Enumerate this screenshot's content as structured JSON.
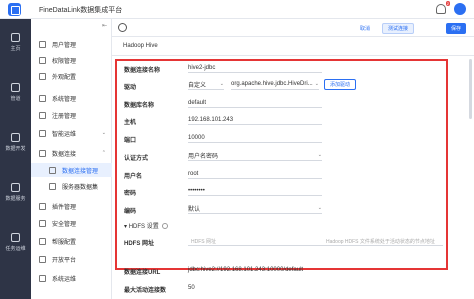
{
  "app": {
    "title": "FineDataLink数据集成平台",
    "notification_count": "2"
  },
  "rail": [
    {
      "label": "主页",
      "icon": "home-icon"
    },
    {
      "label": "管道",
      "icon": "pipeline-icon"
    },
    {
      "label": "数据开发",
      "icon": "dev-icon"
    },
    {
      "label": "数据服务",
      "icon": "service-icon"
    },
    {
      "label": "任务运维",
      "icon": "ops-icon"
    }
  ],
  "sidenav": [
    {
      "label": "用户管理",
      "icon": "user-icon"
    },
    {
      "label": "权限管理",
      "icon": "permission-icon"
    },
    {
      "label": "外观配置",
      "icon": "appearance-icon"
    },
    {
      "label": "系统管理",
      "icon": "system-icon"
    },
    {
      "label": "注册管理",
      "icon": "register-icon"
    },
    {
      "label": "智能运维",
      "icon": "ai-ops-icon"
    },
    {
      "label": "数据连接",
      "icon": "connection-icon"
    },
    {
      "label": "数据连接管理",
      "icon": "connection-manage-icon",
      "active": true
    },
    {
      "label": "服务器数据集",
      "icon": "dataset-icon"
    },
    {
      "label": "插件管理",
      "icon": "plugin-icon"
    },
    {
      "label": "安全管理",
      "icon": "security-icon"
    },
    {
      "label": "帮服配置",
      "icon": "help-config-icon"
    },
    {
      "label": "开放平台",
      "icon": "open-platform-icon"
    },
    {
      "label": "系统运维",
      "icon": "maintenance-icon"
    }
  ],
  "toolbar": {
    "cancel": "取消",
    "test": "测试连接",
    "save": "保存"
  },
  "connection": {
    "name": "Hadoop Hive"
  },
  "form": {
    "name_label": "数据连接名称",
    "name_value": "hive2-jdbc",
    "driver_label": "驱动",
    "driver_mode": "自定义",
    "driver_class": "org.apache.hive.jdbc.HiveDri...",
    "add_driver": "添加驱动",
    "db_label": "数据库名称",
    "db_value": "default",
    "host_label": "主机",
    "host_value": "192.168.101.243",
    "port_label": "端口",
    "port_value": "10000",
    "auth_label": "认证方式",
    "auth_value": "用户名密码",
    "user_label": "用户名",
    "user_value": "root",
    "pwd_label": "密码",
    "pwd_value": "••••••••",
    "enc_label": "编码",
    "enc_value": "默认",
    "hdfs_toggle": "HDFS 设置",
    "hdfs_label": "HDFS 网址",
    "hdfs_placeholder": "HDFS 网址",
    "hdfs_hint": "Hadoop HDFS 文件系统处于活动状态的节点地址"
  },
  "extra": {
    "url_label": "数据连接URL",
    "url_value": "jdbc:hive2://192.168.101.243:10000/default",
    "max_label": "最大活动连接数",
    "max_value": "50"
  }
}
